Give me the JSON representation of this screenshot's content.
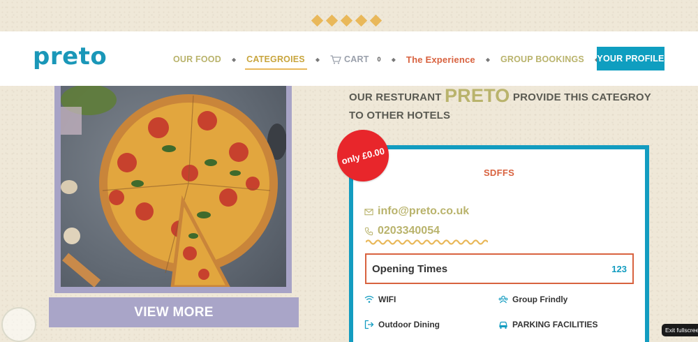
{
  "header": {
    "logo": "preto",
    "nav": [
      {
        "label": "OUR FOOD"
      },
      {
        "label": "CATEGROIES"
      },
      {
        "label": "CART",
        "count": "0"
      },
      {
        "label": "The Experience"
      },
      {
        "label": "GROUP BOOKINGS"
      }
    ],
    "profile_label": "YOUR PROFILE"
  },
  "left": {
    "view_more_label": "VIEW MORE"
  },
  "heading": {
    "pre": "OUR RESTURANT ",
    "brand": "PRETO",
    "post": " PROVIDE THIS CATEGROY TO OTHER HOTELS"
  },
  "card": {
    "price_badge": "only £0.00",
    "title": "SDFFS",
    "email": "info@preto.co.uk",
    "phone": "0203340054",
    "opening_label": "Opening Times",
    "opening_value": "123",
    "amenities": [
      {
        "label": "WIFI",
        "icon": "wifi-icon"
      },
      {
        "label": "Group Frindly",
        "icon": "group-icon"
      },
      {
        "label": "Outdoor Dining",
        "icon": "outdoor-icon"
      },
      {
        "label": "PARKING FACILITIES",
        "icon": "car-icon"
      }
    ]
  },
  "overlay": {
    "exit_fullscreen": "Exit fullscreen"
  },
  "colors": {
    "brand_blue": "#139cc0",
    "olive": "#b9b36c",
    "orange": "#d8623f",
    "badge_red": "#e8262b",
    "lavender": "#a9a5c8"
  }
}
